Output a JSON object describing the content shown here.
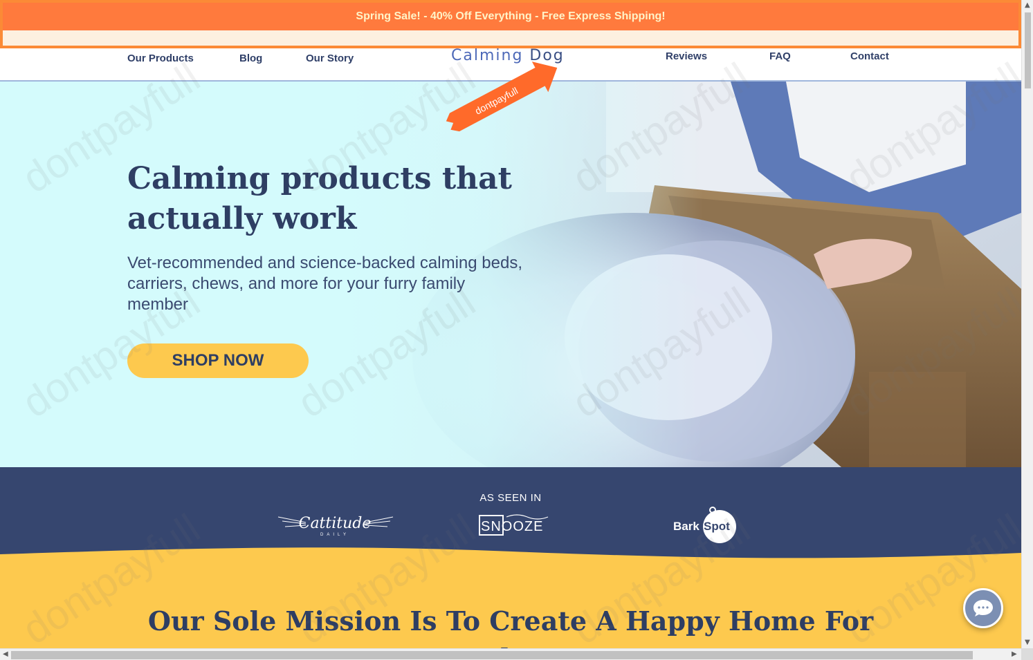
{
  "announcement": {
    "text": "Spring Sale! - 40% Off Everything - Free Express Shipping!"
  },
  "nav": {
    "left": [
      {
        "label": "Our Products"
      },
      {
        "label": "Blog"
      },
      {
        "label": "Our Story"
      }
    ],
    "right": [
      {
        "label": "Reviews"
      },
      {
        "label": "FAQ"
      },
      {
        "label": "Contact"
      }
    ],
    "logo": {
      "part1": "Calming ",
      "part2": "Dog"
    }
  },
  "promo_ribbon": {
    "text": "dontpayfull"
  },
  "hero": {
    "title": "Calming products that actually work",
    "subtitle": "Vet-recommended and science-backed calming beds, carriers, chews, and more for your furry family member",
    "cta_label": "SHOP NOW"
  },
  "seen_in": {
    "label": "AS SEEN IN",
    "logos": [
      {
        "name": "Cattitude",
        "sub": "DAILY"
      },
      {
        "name": "SNOOZE"
      },
      {
        "name1": "Bark",
        "name2": "Spot"
      }
    ]
  },
  "mission": {
    "title": "Our Sole Mission Is To Create A Happy Home For You And Your Pe"
  },
  "watermark": {
    "text": "dontpayfull"
  },
  "colors": {
    "announce_bg": "#ff7a3d",
    "navy": "#2e3e63",
    "hero_bg": "#d4fbfc",
    "cta_yellow": "#fdc94e",
    "band_navy": "#36466f"
  },
  "icons": {
    "chat": "chat-bubble-icon",
    "scroll_left": "chevron-left-icon",
    "scroll_right": "chevron-right-icon",
    "scroll_up": "chevron-up-icon",
    "scroll_down": "chevron-down-icon"
  }
}
